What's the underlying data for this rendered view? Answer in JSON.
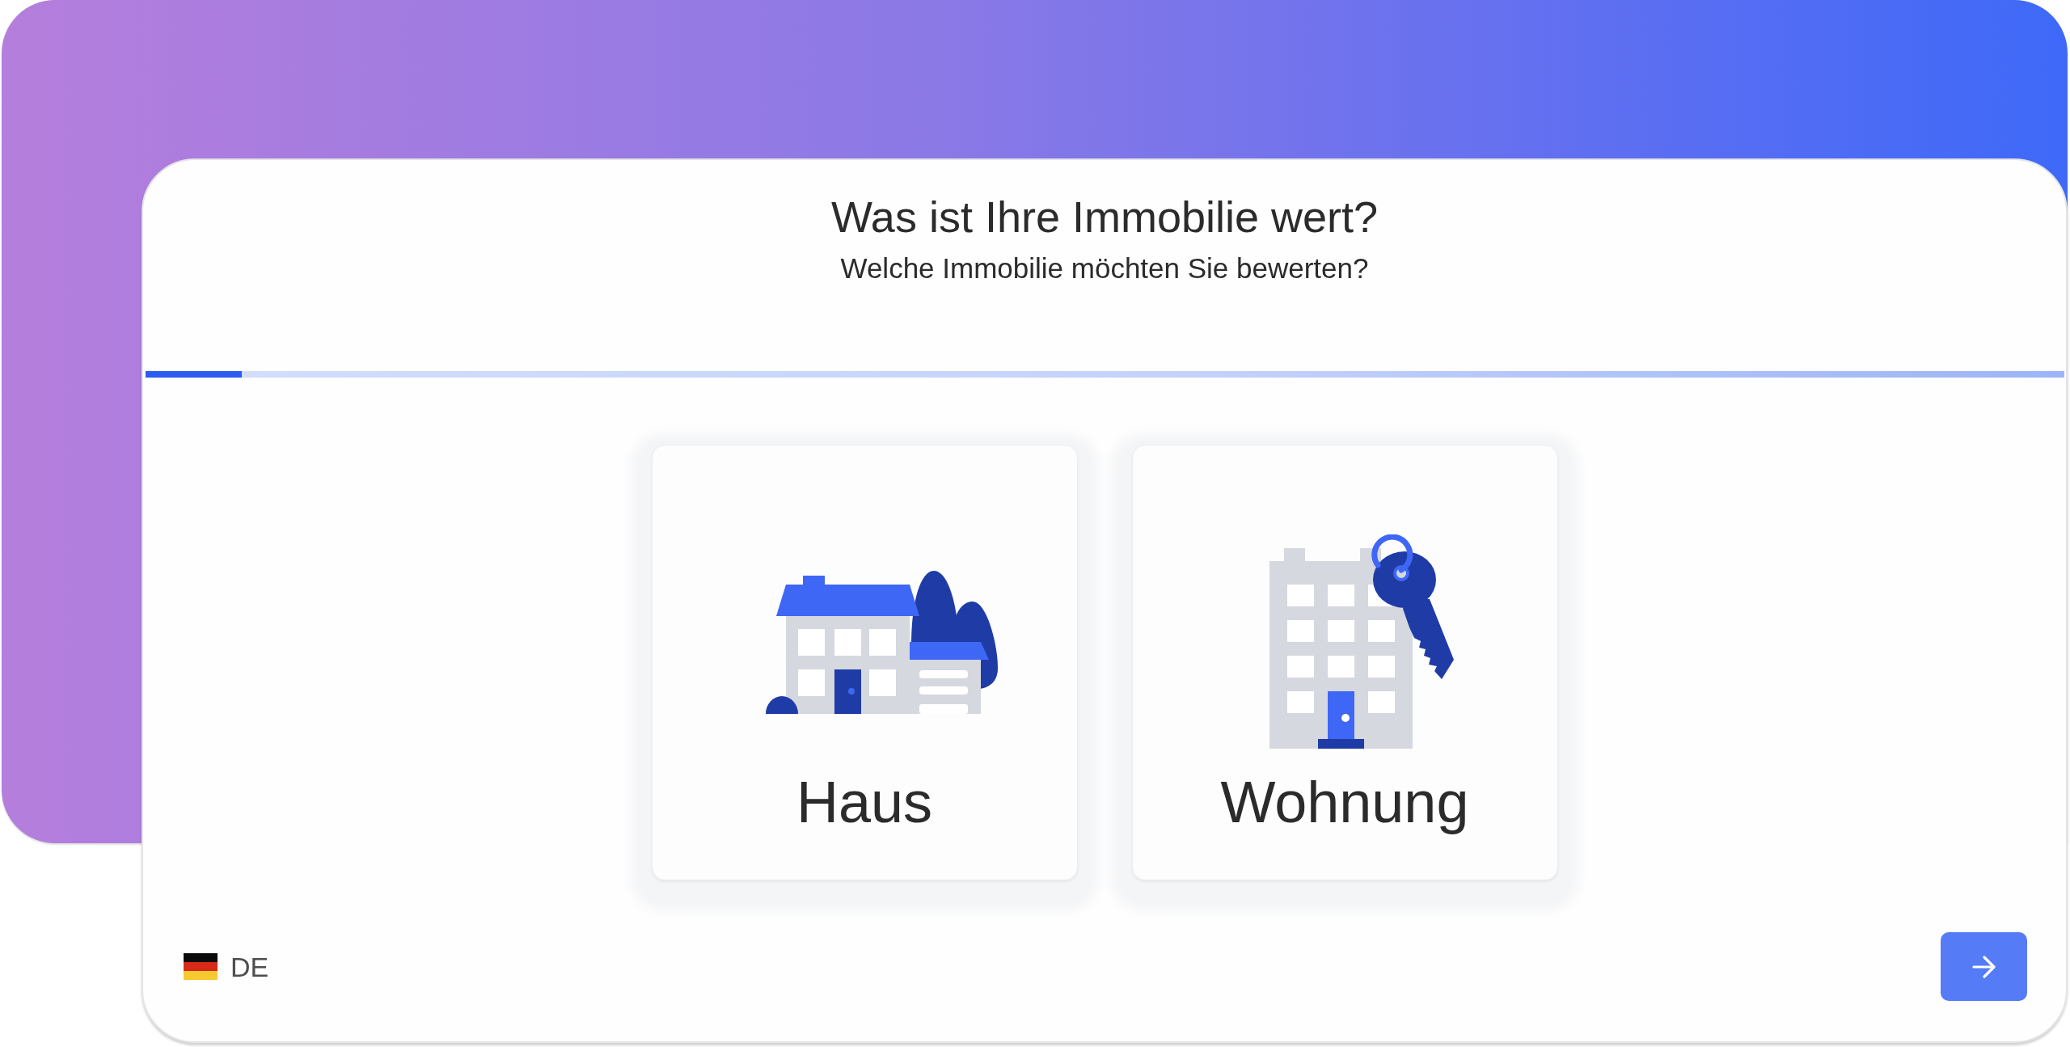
{
  "title": "Was ist Ihre Immobilie wert?",
  "subtitle": "Welche Immobilie möchten Sie bewerten?",
  "progress": {
    "level": 0.05
  },
  "options": [
    {
      "kind": "house",
      "label": "Haus",
      "selected": false
    },
    {
      "kind": "apartment",
      "label": "Wohnung",
      "selected": false
    }
  ],
  "language_selector": {
    "label": "DE"
  }
}
